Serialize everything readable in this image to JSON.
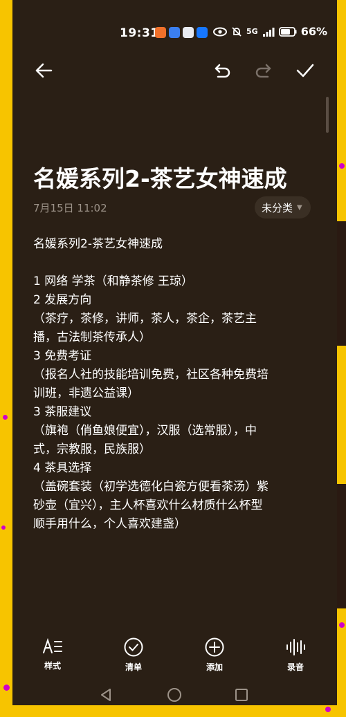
{
  "status_bar": {
    "time": "19:31",
    "network": "5G",
    "battery": "66%",
    "notification_icons": [
      "app-icon-orange",
      "app-icon-blue",
      "weibo-icon",
      "alipay-icon"
    ],
    "system_icons": [
      "eye-icon",
      "mute-icon",
      "signal-icon",
      "battery-icon"
    ]
  },
  "toolbar": {
    "back_icon": "arrow-left-icon",
    "undo_icon": "undo-icon",
    "redo_icon": "redo-icon",
    "done_icon": "checkmark-icon"
  },
  "note": {
    "title": "名媛系列2-茶艺女神速成",
    "date": "7月15日 11:02",
    "category": "未分类",
    "lines": [
      "名媛系列2-茶艺女神速成",
      "",
      "1 网络 学茶（和静茶修 王琼）",
      "2 发展方向",
      "（茶疗，茶修，讲师，茶人，茶企，茶艺主",
      "播，古法制茶传承人）",
      "3 免费考证",
      "（报名人社的技能培训免费，社区各种免费培",
      "训班，非遗公益课）",
      "3 茶服建议",
      "（旗袍（俏鱼娘便宜），汉服（选常服），中",
      "式，宗教服，民族服）",
      "4 茶具选择",
      "（盖碗套装（初学选德化白瓷方便看茶汤）紫",
      "砂壶（宜兴），主人杯喜欢什么材质什么杯型",
      "顺手用什么，个人喜欢建盏）"
    ]
  },
  "bottom_bar": {
    "style_label": "样式",
    "checklist_label": "清单",
    "add_label": "添加",
    "record_label": "录音"
  },
  "colors": {
    "background": "#2a1f15",
    "frame": "#f7c400",
    "text": "#ffffff",
    "muted": "#9d9389"
  }
}
